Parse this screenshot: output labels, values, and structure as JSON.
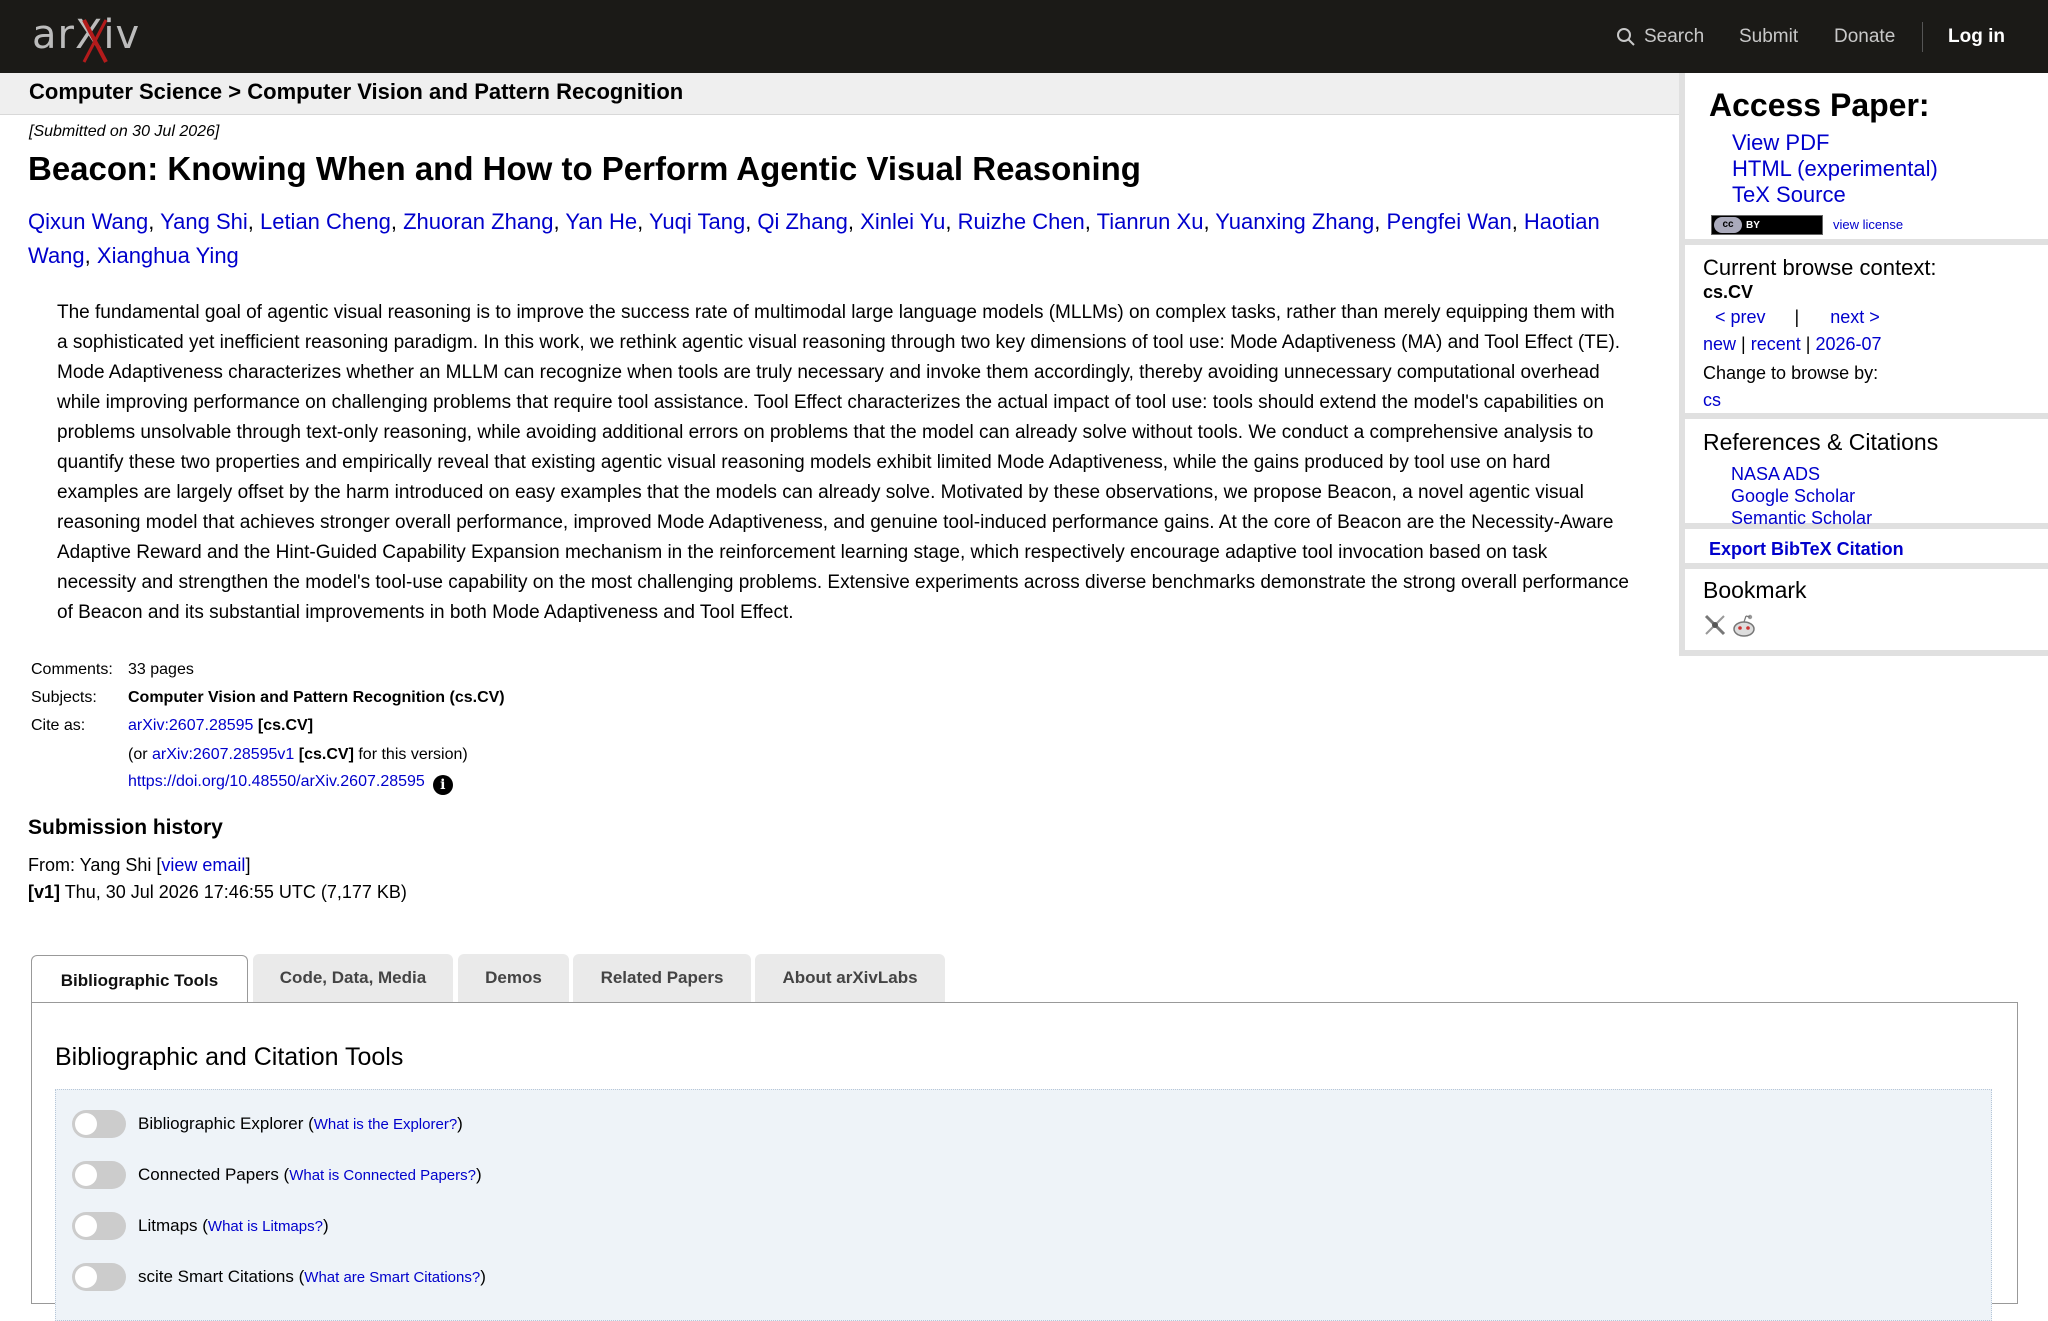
{
  "header": {
    "logo_text": "arXiv",
    "nav": {
      "search": "Search",
      "submit": "Submit",
      "donate": "Donate",
      "login": "Log in"
    }
  },
  "breadcrumb": "Computer Science > Computer Vision and Pattern Recognition",
  "paper": {
    "submitted": "[Submitted on 30 Jul 2026]",
    "title": "Beacon: Knowing When and How to Perform Agentic Visual Reasoning",
    "authors": [
      "Qixun Wang",
      "Yang Shi",
      "Letian Cheng",
      "Zhuoran Zhang",
      "Yan He",
      "Yuqi Tang",
      "Qi Zhang",
      "Xinlei Yu",
      "Ruizhe Chen",
      "Tianrun Xu",
      "Yuanxing Zhang",
      "Pengfei Wan",
      "Haotian Wang",
      "Xianghua Ying"
    ],
    "abstract": "The fundamental goal of agentic visual reasoning is to improve the success rate of multimodal large language models (MLLMs) on complex tasks, rather than merely equipping them with a sophisticated yet inefficient reasoning paradigm. In this work, we rethink agentic visual reasoning through two key dimensions of tool use: Mode Adaptiveness (MA) and Tool Effect (TE). Mode Adaptiveness characterizes whether an MLLM can recognize when tools are truly necessary and invoke them accordingly, thereby avoiding unnecessary computational overhead while improving performance on challenging problems that require tool assistance. Tool Effect characterizes the actual impact of tool use: tools should extend the model's capabilities on problems unsolvable through text-only reasoning, while avoiding additional errors on problems that the model can already solve without tools. We conduct a comprehensive analysis to quantify these two properties and empirically reveal that existing agentic visual reasoning models exhibit limited Mode Adaptiveness, while the gains produced by tool use on hard examples are largely offset by the harm introduced on easy examples that the models can already solve. Motivated by these observations, we propose Beacon, a novel agentic visual reasoning model that achieves stronger overall performance, improved Mode Adaptiveness, and genuine tool-induced performance gains. At the core of Beacon are the Necessity-Aware Adaptive Reward and the Hint-Guided Capability Expansion mechanism in the reinforcement learning stage, which respectively encourage adaptive tool invocation based on task necessity and strengthen the model's tool-use capability on the most challenging problems. Extensive experiments across diverse benchmarks demonstrate the strong overall performance of Beacon and its substantial improvements in both Mode Adaptiveness and Tool Effect."
  },
  "meta": {
    "comments_label": "Comments:",
    "comments": "33 pages",
    "subjects_label": "Subjects:",
    "subjects": "Computer Vision and Pattern Recognition (cs.CV)",
    "cite_label": "Cite as:",
    "cite_id": "arXiv:2607.28595",
    "cite_cat": "[cs.CV]",
    "or_prefix": "(or ",
    "cite_version": "arXiv:2607.28595v1",
    "or_cat": "[cs.CV]",
    "or_suffix": " for this version)",
    "doi": "https://doi.org/10.48550/arXiv.2607.28595",
    "info_icon": "i"
  },
  "history": {
    "title": "Submission history",
    "from_prefix": "From: Yang Shi [",
    "view_email": "view email",
    "from_suffix": "]",
    "v1_label": "[v1]",
    "v1_text": " Thu, 30 Jul 2026 17:46:55 UTC (7,177 KB)"
  },
  "tabs": [
    "Bibliographic Tools",
    "Code, Data, Media",
    "Demos",
    "Related Papers",
    "About arXivLabs"
  ],
  "panel": {
    "title": "Bibliographic and Citation Tools",
    "tools": [
      {
        "name": "Bibliographic Explorer",
        "link": "What is the Explorer?"
      },
      {
        "name": "Connected Papers",
        "link": "What is Connected Papers?"
      },
      {
        "name": "Litmaps",
        "link": "What is Litmaps?"
      },
      {
        "name": "scite Smart Citations",
        "link": "What are Smart Citations?"
      }
    ]
  },
  "sidebar": {
    "access_title": "Access Paper:",
    "access_links": [
      "View PDF",
      "HTML (experimental)",
      "TeX Source"
    ],
    "cc_text": "cc",
    "cc_by": "BY",
    "view_license": "view license",
    "context_title": "Current browse context:",
    "context_cat": "cs.CV",
    "prev": "< prev",
    "sep": "|",
    "next": "next >",
    "new": "new",
    "recent": "recent",
    "month": "2026-07",
    "change_browse": "Change to browse by:",
    "change_cs": "cs",
    "refs_title": "References & Citations",
    "refs_links": [
      "NASA ADS",
      "Google Scholar",
      "Semantic Scholar"
    ],
    "export_bibtex": "Export BibTeX Citation",
    "bookmark_title": "Bookmark"
  }
}
